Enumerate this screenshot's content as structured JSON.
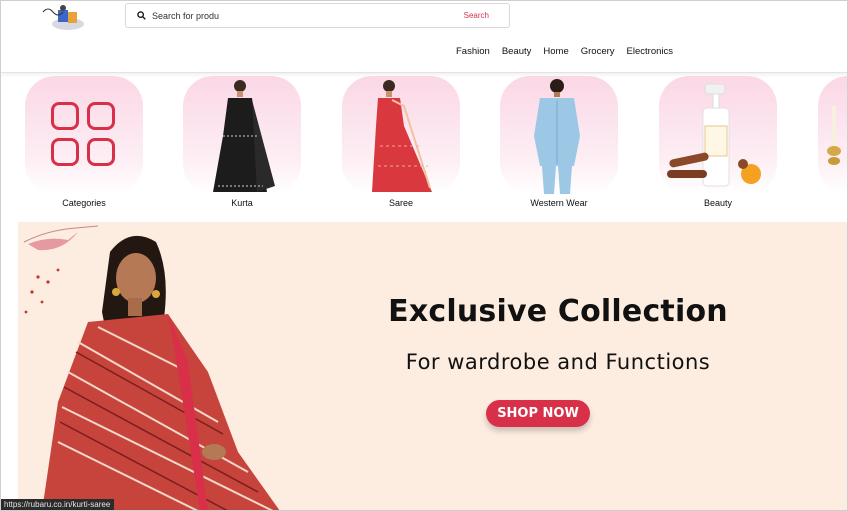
{
  "header": {
    "search": {
      "value": "Search for produ",
      "placeholder": "Search for produ",
      "button_label": "Search"
    },
    "nav": [
      "Fashion",
      "Beauty",
      "Home",
      "Grocery",
      "Electronics"
    ]
  },
  "categories": [
    {
      "label": "Categories",
      "icon": "grid-icon"
    },
    {
      "label": "Kurta"
    },
    {
      "label": "Saree"
    },
    {
      "label": "Western Wear"
    },
    {
      "label": "Beauty"
    }
  ],
  "banner": {
    "title": "Exclusive Collection",
    "subtitle": "For wardrobe and Functions",
    "cta": "SHOP NOW"
  },
  "status_bar": {
    "url": "https://rubaru.co.in/kurti-saree"
  },
  "colors": {
    "accent": "#d9304a",
    "tile_bg": "#fbd7e5",
    "banner_bg": "#fdece0"
  }
}
